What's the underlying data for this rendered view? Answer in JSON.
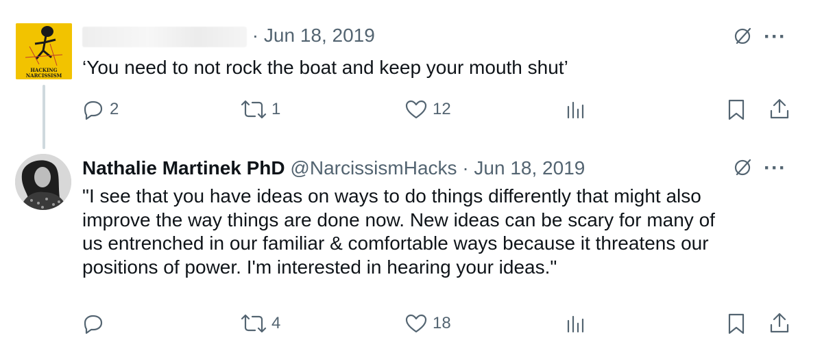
{
  "tweets": [
    {
      "author_name": "",
      "handle": "",
      "date": "Jun 18, 2019",
      "text": "‘You need to not rock the boat and keep your mouth shut’",
      "avatar_text_line1": "HACKING",
      "avatar_text_line2": "NARCISSISM",
      "replies": "2",
      "retweets": "1",
      "likes": "12"
    },
    {
      "author_name": "Nathalie Martinek PhD",
      "handle": "@NarcissismHacks",
      "date": "Jun 18, 2019",
      "text_lines": [
        "\"I see that you have ideas on ways to do things differently that might also",
        "improve the way things are done now. New ideas can be scary for many of",
        "us entrenched in our familiar & comfortable ways because it threatens our",
        "positions of power. I'm interested in hearing your ideas.\""
      ],
      "replies": "",
      "retweets": "4",
      "likes": "18"
    }
  ],
  "separator": "·",
  "more_glyph": "···",
  "icons": [
    "reply-icon",
    "retweet-icon",
    "like-icon",
    "views-icon",
    "bookmark-icon",
    "share-icon",
    "grok-icon",
    "more-icon"
  ],
  "colors": {
    "muted": "#536471",
    "text": "#0f1419",
    "thread_line": "#cfd9de",
    "avatar_yellow": "#f2c300"
  }
}
